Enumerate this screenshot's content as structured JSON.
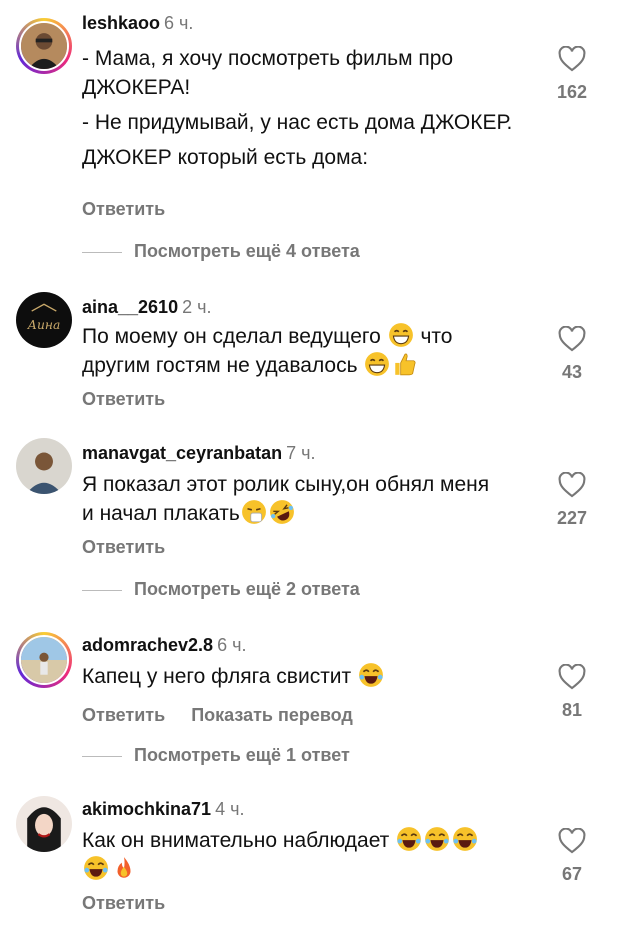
{
  "comments": [
    {
      "username": "leshkaoo",
      "time": "6 ч.",
      "lines": [
        "- Мама, я хочу посмотреть фильм про ДЖОКЕРА!",
        "- Не придумывай, у нас есть дома ДЖОКЕР.",
        "ДЖОКЕР который есть дома:"
      ],
      "likes": "162",
      "reply": "Ответить",
      "more": "Посмотреть ещё 4 ответа",
      "avatar_icon": "avatar-man-icon"
    },
    {
      "username": "aina__2610",
      "time": "2 ч.",
      "text1": "По моему он сделал ведущего",
      "text1b": "что",
      "text2": "другим гостям не удавалось",
      "likes": "43",
      "reply": "Ответить",
      "avatar_icon": "avatar-logo-icon",
      "avatar_text": "Аина"
    },
    {
      "username": "manavgat_ceyranbatan",
      "time": "7 ч.",
      "text1": "Я показал этот ролик сыну,он обнял меня",
      "text2": "и начал плакать",
      "likes": "227",
      "reply": "Ответить",
      "more": "Посмотреть ещё 2 ответа",
      "avatar_icon": "avatar-man-icon"
    },
    {
      "username": "adomrachev2.8",
      "time": "6 ч.",
      "text1": "Капец у него фляга свистит",
      "likes": "81",
      "reply": "Ответить",
      "translate": "Показать перевод",
      "more": "Посмотреть ещё 1 ответ",
      "avatar_icon": "avatar-beach-icon"
    },
    {
      "username": "akimochkina71",
      "time": "4 ч.",
      "text1": "Как он внимательно наблюдает",
      "likes": "67",
      "reply": "Ответить",
      "avatar_icon": "avatar-portrait-icon"
    }
  ],
  "colors": {
    "secondary": "#777777",
    "text": "#111111",
    "emoji": "#f7c22a"
  }
}
